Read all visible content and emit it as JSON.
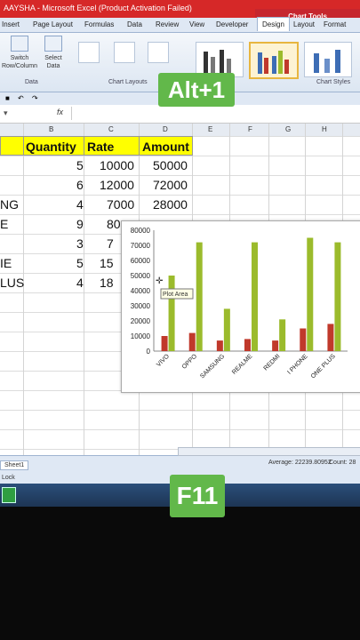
{
  "window": {
    "title": "AAYSHA - Microsoft Excel (Product Activation Failed)",
    "context_tab_group": "Chart Tools"
  },
  "tabs": [
    "Insert",
    "Page Layout",
    "Formulas",
    "Data",
    "Review",
    "View",
    "Developer",
    "Design",
    "Layout",
    "Format"
  ],
  "active_tab": "Design",
  "ribbon": {
    "switch_row_column": "Switch Row/Column",
    "select_data": "Select Data",
    "group_data": "Data",
    "group_chart_layouts": "Chart Layouts",
    "group_chart_styles": "Chart Styles"
  },
  "formula_bar": {
    "fx": "fx"
  },
  "columns": [
    "B",
    "C",
    "D",
    "E",
    "F",
    "G",
    "H"
  ],
  "table": {
    "headers": [
      "Quantity",
      "Rate",
      "Amount"
    ],
    "rows": [
      {
        "a": "",
        "qty": "5",
        "rate": "10000",
        "amt": "50000"
      },
      {
        "a": "",
        "qty": "6",
        "rate": "12000",
        "amt": "72000"
      },
      {
        "a": "NG",
        "qty": "4",
        "rate": "7000",
        "amt": "28000"
      },
      {
        "a": "E",
        "qty": "9",
        "rate": "80",
        "amt": ""
      },
      {
        "a": "",
        "qty": "3",
        "rate": "7",
        "amt": ""
      },
      {
        "a": "IE",
        "qty": "5",
        "rate": "15",
        "amt": ""
      },
      {
        "a": "LUS",
        "qty": "4",
        "rate": "18",
        "amt": ""
      }
    ]
  },
  "chart_data": {
    "type": "bar",
    "categories": [
      "VIVO",
      "OPPO",
      "SAMSUNG",
      "REALME",
      "REDMI",
      "I PHONE",
      "ONE PLUS"
    ],
    "series": [
      {
        "values": [
          10000,
          12000,
          7000,
          8000,
          7000,
          15000,
          18000
        ],
        "color": "#c0392b"
      },
      {
        "values": [
          50000,
          72000,
          28000,
          72000,
          21000,
          75000,
          72000
        ],
        "color": "#9bbb2c"
      }
    ],
    "yticks": [
      "0",
      "10000",
      "20000",
      "30000",
      "40000",
      "50000",
      "60000",
      "70000",
      "80000"
    ],
    "ylim": [
      0,
      80000
    ],
    "tooltip": "Plot Area",
    "grid": false
  },
  "status": {
    "sheet_tab": "Sheet1",
    "average": "Average: 22239.80952",
    "count": "Count: 28",
    "mode": "Lock"
  },
  "overlays": {
    "top": "Alt+1",
    "bottom": "F11"
  }
}
